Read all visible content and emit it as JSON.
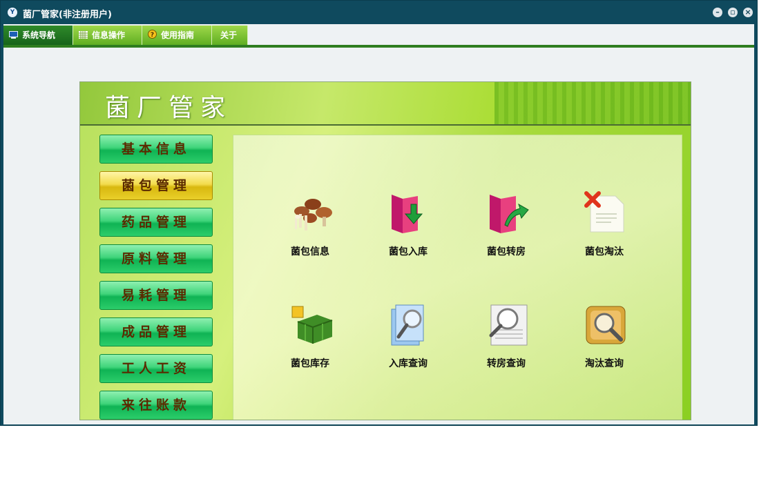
{
  "window": {
    "title": "菌厂管家(非注册用户)",
    "app_icon_text": "Y",
    "buttons": [
      "minimize",
      "restore",
      "close"
    ]
  },
  "menu": {
    "items": [
      {
        "label": "系统导航",
        "icon": "monitor-icon",
        "active": true
      },
      {
        "label": "信息操作",
        "icon": "grid-icon",
        "active": false
      },
      {
        "label": "使用指南",
        "icon": "help-icon",
        "active": false
      },
      {
        "label": "关于",
        "icon": "",
        "active": false
      }
    ]
  },
  "panel": {
    "title": "菌厂管家"
  },
  "nav": {
    "items": [
      "基本信息",
      "菌包管理",
      "药品管理",
      "原料管理",
      "易耗管理",
      "成品管理",
      "工人工资",
      "来往账款"
    ],
    "selected": "菌包管理"
  },
  "functions": {
    "items": [
      {
        "label": "菌包信息",
        "icon": "mushrooms-icon"
      },
      {
        "label": "菌包入库",
        "icon": "folder-in-icon"
      },
      {
        "label": "菌包转房",
        "icon": "folder-transfer-icon"
      },
      {
        "label": "菌包淘汰",
        "icon": "delete-document-icon"
      },
      {
        "label": "菌包库存",
        "icon": "cubes-icon"
      },
      {
        "label": "入库查询",
        "icon": "document-search-icon"
      },
      {
        "label": "转房查询",
        "icon": "scroll-search-icon"
      },
      {
        "label": "淘汰查询",
        "icon": "box-search-icon"
      }
    ]
  },
  "colors": {
    "titlebar": "#0f4a5e",
    "menu_active": "#17641a",
    "menu_inactive": "#5fae22",
    "nav_green": "#0fb354",
    "nav_selected": "#d8b80f"
  }
}
